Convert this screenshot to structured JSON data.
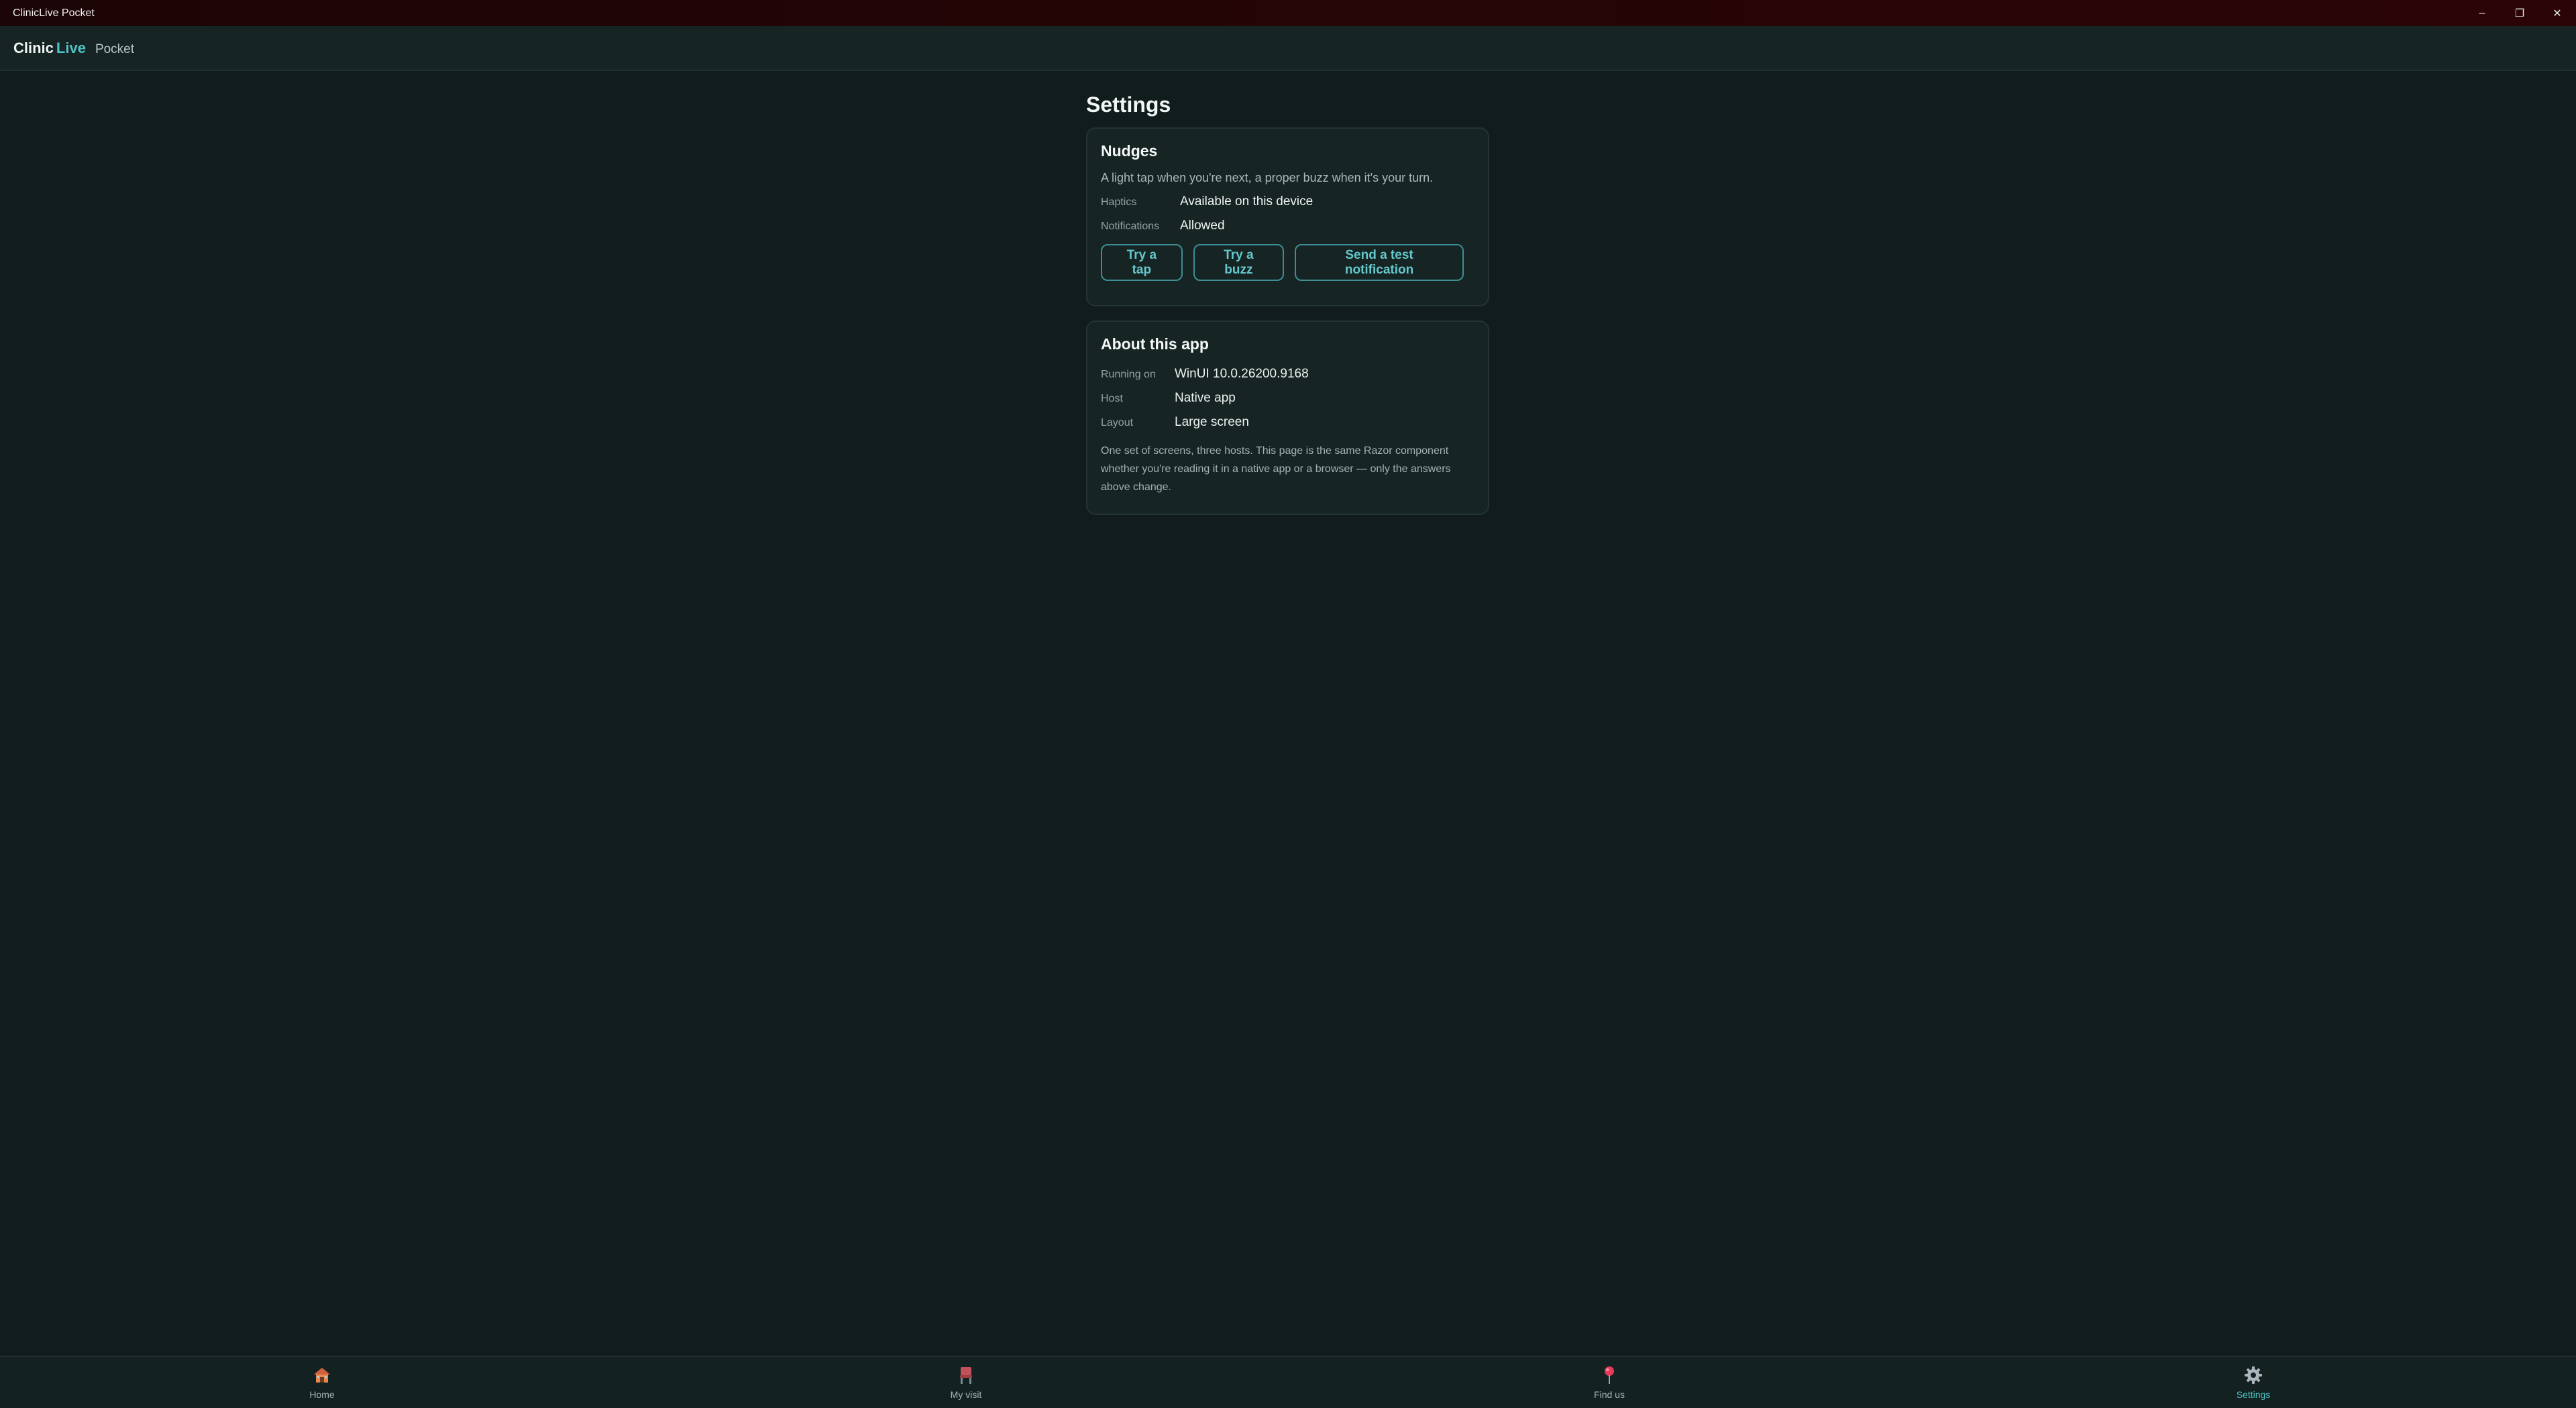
{
  "window": {
    "title": "ClinicLive Pocket",
    "controls": {
      "minimize": "–",
      "restore": "❐",
      "close": "✕"
    }
  },
  "brand": {
    "part1": "Clinic",
    "part2": "Live",
    "part3": "Pocket"
  },
  "page": {
    "title": "Settings"
  },
  "nudges": {
    "title": "Nudges",
    "lede": "A light tap when you're next, a proper buzz when it's your turn.",
    "rows": [
      {
        "key": "Haptics",
        "value": "Available on this device"
      },
      {
        "key": "Notifications",
        "value": "Allowed"
      }
    ],
    "buttons": {
      "tap": "Try a tap",
      "buzz": "Try a buzz",
      "notify": "Send a test notification"
    }
  },
  "about": {
    "title": "About this app",
    "rows": [
      {
        "key": "Running on",
        "value": "WinUI 10.0.26200.9168"
      },
      {
        "key": "Host",
        "value": "Native app"
      },
      {
        "key": "Layout",
        "value": "Large screen"
      }
    ],
    "note": "One set of screens, three hosts. This page is the same Razor component whether you're reading it in a native app or a browser — only the answers above change."
  },
  "nav": {
    "items": [
      {
        "label": "Home",
        "icon": "home-icon"
      },
      {
        "label": "My visit",
        "icon": "chair-icon"
      },
      {
        "label": "Find us",
        "icon": "pin-icon"
      },
      {
        "label": "Settings",
        "icon": "gear-icon",
        "active": true
      }
    ]
  },
  "colors": {
    "accent": "#4fc3c6",
    "background": "#111c1c",
    "card": "#172424"
  }
}
